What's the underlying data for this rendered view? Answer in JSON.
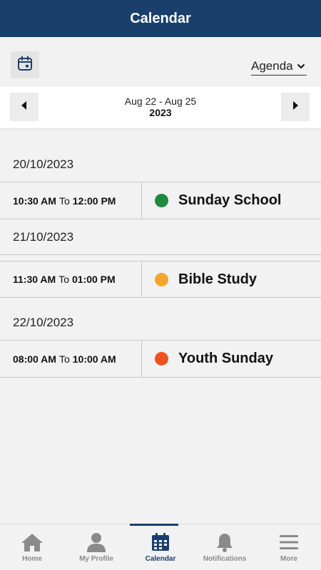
{
  "header": {
    "title": "Calendar"
  },
  "toolbar": {
    "view_selected": "Agenda"
  },
  "range": {
    "dates": "Aug 22 - Aug 25",
    "year": "2023"
  },
  "agenda": [
    {
      "date": "20/10/2023",
      "start": "10:30 AM",
      "to": "To",
      "end": "12:00 PM",
      "title": "Sunday School",
      "color": "#1e8a3e"
    },
    {
      "date": "21/10/2023",
      "start": "11:30 AM",
      "to": "To",
      "end": "01:00 PM",
      "title": "Bible Study",
      "color": "#f2a62a"
    },
    {
      "date": "22/10/2023",
      "start": "08:00 AM",
      "to": "To",
      "end": "10:00 AM",
      "title": "Youth Sunday",
      "color": "#f0521e"
    }
  ],
  "nav": {
    "home": "Home",
    "profile": "My Profile",
    "calendar": "Calendar",
    "notifications": "Notifications",
    "more": "More"
  },
  "colors": {
    "brand": "#1a3f6b",
    "inactive": "#8a8a8a"
  }
}
